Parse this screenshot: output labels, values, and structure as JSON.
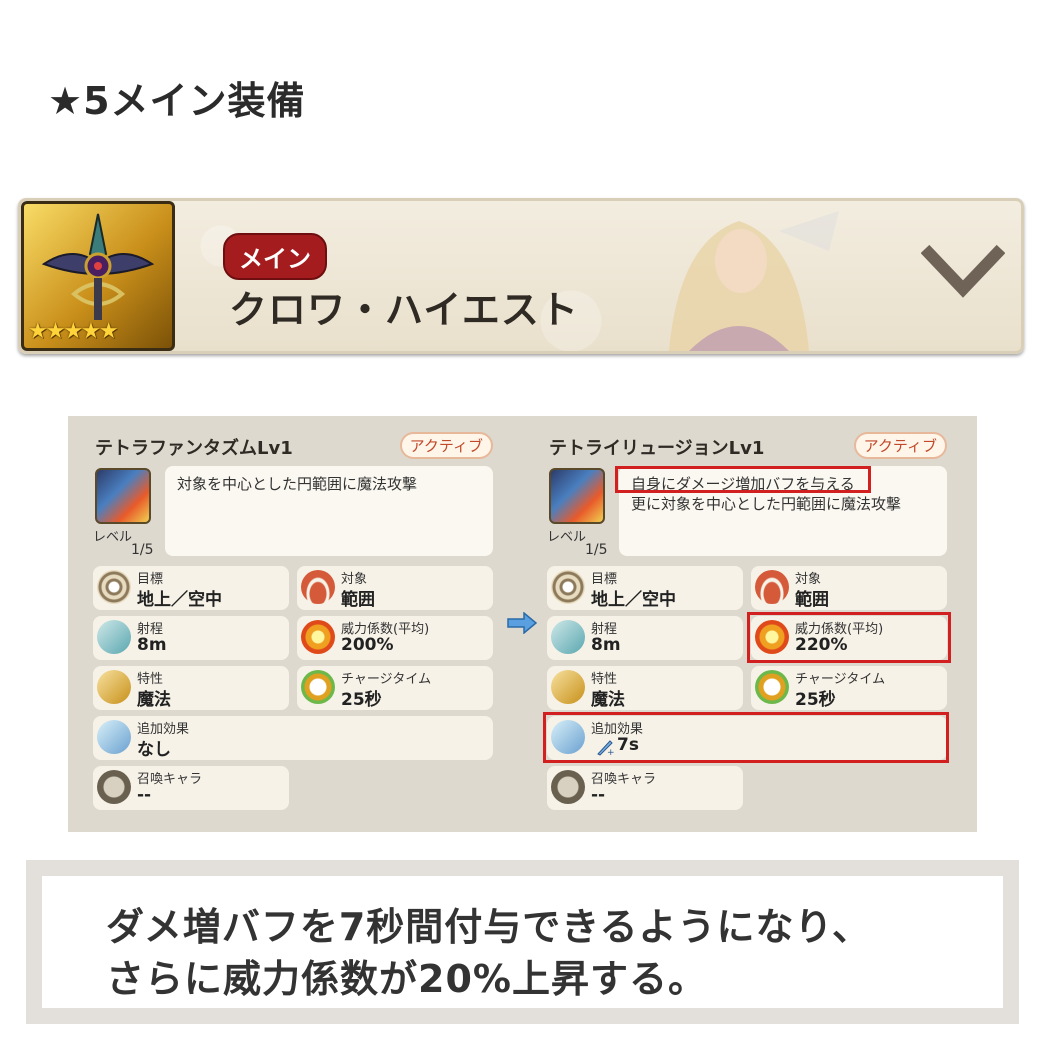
{
  "title": "★5メイン装備",
  "banner": {
    "tag": "メイン",
    "name": "クロワ・ハイエスト",
    "stars": "★★★★★"
  },
  "skills": [
    {
      "name": "テトラファンタズムLv1",
      "type": "アクティブ",
      "desc_lines": [
        "対象を中心とした円範囲に魔法攻撃"
      ],
      "level_label": "レベル",
      "level_value": "1/5",
      "target_label": "目標",
      "target_value": "地上／空中",
      "object_label": "対象",
      "object_value": "範囲",
      "range_label": "射程",
      "range_value": "8m",
      "power_label": "威力係数(平均)",
      "power_value": "200%",
      "attr_label": "特性",
      "attr_value": "魔法",
      "charge_label": "チャージタイム",
      "charge_value": "25秒",
      "extra_label": "追加効果",
      "extra_value": "なし",
      "summon_label": "召喚キャラ",
      "summon_value": "--"
    },
    {
      "name": "テトライリュージョンLv1",
      "type": "アクティブ",
      "desc_lines": [
        "自身にダメージ増加バフを与える",
        "更に対象を中心とした円範囲に魔法攻撃"
      ],
      "level_label": "レベル",
      "level_value": "1/5",
      "target_label": "目標",
      "target_value": "地上／空中",
      "object_label": "対象",
      "object_value": "範囲",
      "range_label": "射程",
      "range_value": "8m",
      "power_label": "威力係数(平均)",
      "power_value": "220%",
      "attr_label": "特性",
      "attr_value": "魔法",
      "charge_label": "チャージタイム",
      "charge_value": "25秒",
      "extra_label": "追加効果",
      "extra_value": "7s",
      "summon_label": "召喚キャラ",
      "summon_value": "--"
    }
  ],
  "note": {
    "line1": "ダメ増バフを7秒間付与できるようになり、",
    "line2": "さらに威力係数が20%上昇する。"
  },
  "colors": {
    "highlight": "#d21f1f",
    "tag_bg": "#a51c1f",
    "arrow": "#4a90d9"
  }
}
